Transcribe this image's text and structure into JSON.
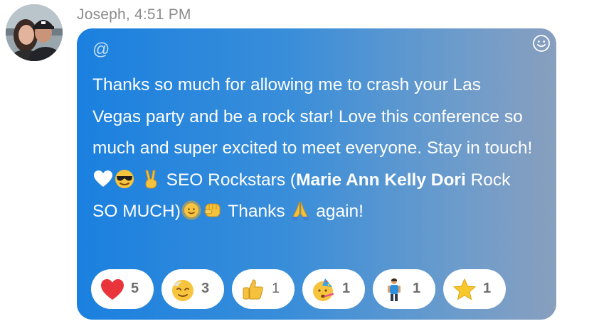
{
  "message": {
    "sender": "Joseph",
    "time": "4:51 PM",
    "sender_time": "Joseph, 4:51 PM",
    "mention_symbol": "@",
    "text_part1": "Thanks so much for allowing me to crash your Las Vegas party and be a rock star! Love this conference so much and super excited to meet everyone. Stay in touch!",
    "text_part2": "SEO Rockstars (",
    "text_bold": "Marie Ann Kelly Dori",
    "text_part3": " Rock SO MUCH)",
    "text_part4": "Thanks",
    "text_part5": "again!",
    "inline_emoji": [
      "heart-icon",
      "sunglasses-face-icon",
      "victory-hand-icon",
      "sun-face-icon",
      "fist-bump-icon",
      "folded-hands-icon"
    ]
  },
  "reactions": [
    {
      "icon": "heart-icon",
      "count": "5"
    },
    {
      "icon": "relieved-face-icon",
      "count": "3"
    },
    {
      "icon": "thumbs-up-icon",
      "count": "1"
    },
    {
      "icon": "party-face-icon",
      "count": "1"
    },
    {
      "icon": "person-standing-icon",
      "count": "1"
    },
    {
      "icon": "star-icon",
      "count": "1"
    }
  ],
  "colors": {
    "bubble_start": "#1a80df",
    "bubble_end": "#889fbe",
    "meta_text": "#8c8c8c",
    "reaction_pill": "#ffffff"
  }
}
